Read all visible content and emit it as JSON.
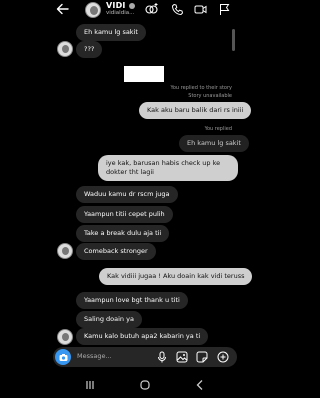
{
  "header": {
    "name": "VIDI",
    "handle": "vidialdia..."
  },
  "messages": [
    {
      "id": "m1",
      "dir": "in",
      "text": "Eh kamu lg sakit"
    },
    {
      "id": "m2",
      "dir": "in",
      "text": "???"
    },
    {
      "id": "m3",
      "dir": "out",
      "text": "Kak aku baru balik dari rs iniii"
    },
    {
      "id": "m4",
      "dir": "out",
      "text": "Eh kamu lg sakit"
    },
    {
      "id": "m5",
      "dir": "out",
      "text": "iye kak, barusan habis check up ke dokter tht lagii"
    },
    {
      "id": "m6",
      "dir": "in",
      "text": "Waduu kamu dr rscm juga"
    },
    {
      "id": "m7",
      "dir": "in",
      "text": "Yaampun titii cepet pulih"
    },
    {
      "id": "m8",
      "dir": "in",
      "text": "Take a break dulu aja tii"
    },
    {
      "id": "m9",
      "dir": "in",
      "text": "Comeback stronger"
    },
    {
      "id": "m10",
      "dir": "out",
      "text": "Kak vidiii jugaa ! Aku doain kak vidi teruss"
    },
    {
      "id": "m11",
      "dir": "in",
      "text": "Yaampun love bgt thank u titi"
    },
    {
      "id": "m12",
      "dir": "in",
      "text": "Saling doain ya"
    },
    {
      "id": "m13",
      "dir": "in",
      "text": "Kamu kalo butuh apa2 kabarin ya ti"
    }
  ],
  "meta": {
    "story_reply": "You replied to their story",
    "story_unavailable": "Story unavailable",
    "you_replied": "You replied"
  },
  "composer": {
    "placeholder": "Message..."
  }
}
